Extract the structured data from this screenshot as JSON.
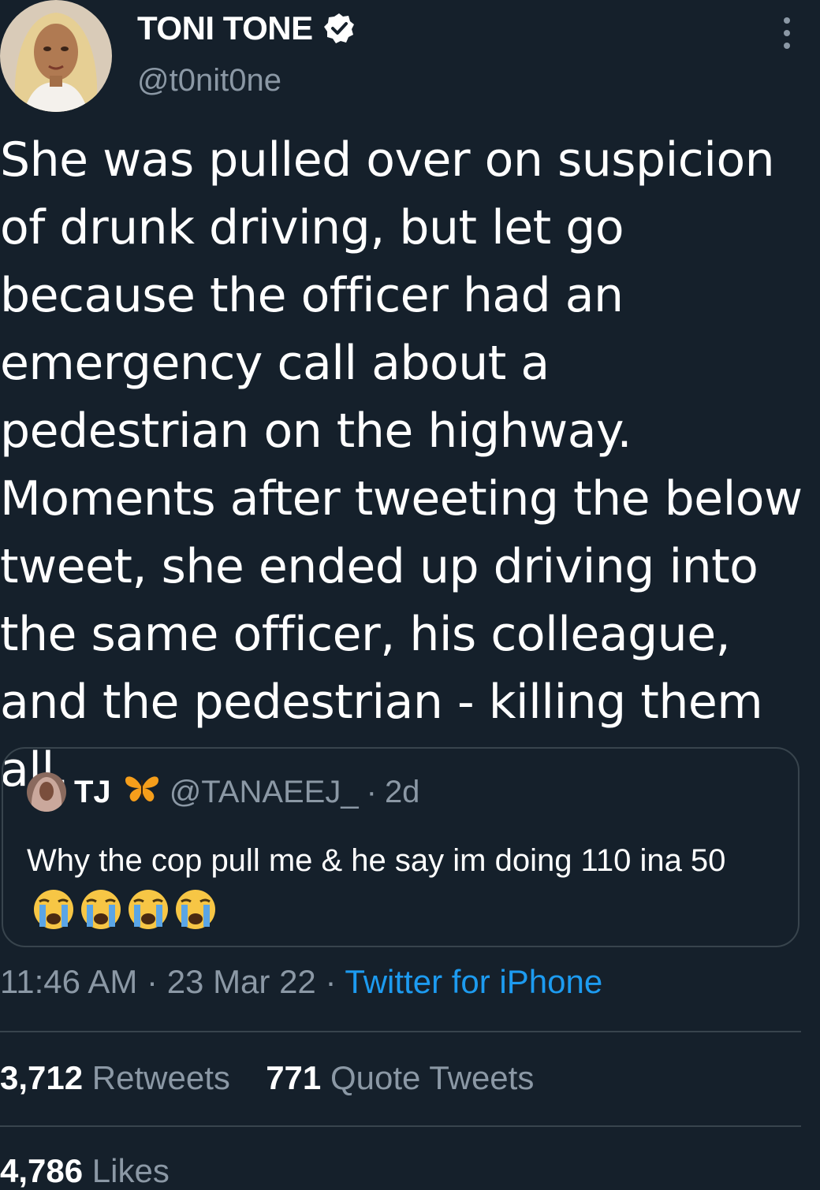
{
  "author": {
    "display_name": "TONI TONE",
    "handle": "@t0nit0ne",
    "verified": true
  },
  "tweet": {
    "text": "She was pulled over on suspicion of drunk driving, but let go because the officer had an emergency call about a pedestrian on the highway. Moments after tweeting the below tweet, she ended up driving into the same officer, his colleague, and the pedestrian - killing them all.",
    "time": "11:46 AM",
    "date": "23 Mar 22",
    "source": "Twitter for iPhone",
    "separator": "·"
  },
  "quoted_tweet": {
    "display_name": "TJ",
    "handle": "@TANAEEJ_",
    "separator": "·",
    "age": "2d",
    "text": "Why the cop pull me & he say im doing 110 ina 50",
    "emojis": [
      "crying-face-icon",
      "crying-face-icon",
      "crying-face-icon",
      "crying-face-icon"
    ]
  },
  "stats": {
    "retweets_count": "3,712",
    "retweets_label": "Retweets",
    "quotes_count": "771",
    "quotes_label": "Quote Tweets",
    "likes_count": "4,786",
    "likes_label": "Likes"
  },
  "colors": {
    "background": "#15202b",
    "secondary_text": "#8b98a5",
    "link": "#1d9bf0",
    "border": "#38444d"
  }
}
